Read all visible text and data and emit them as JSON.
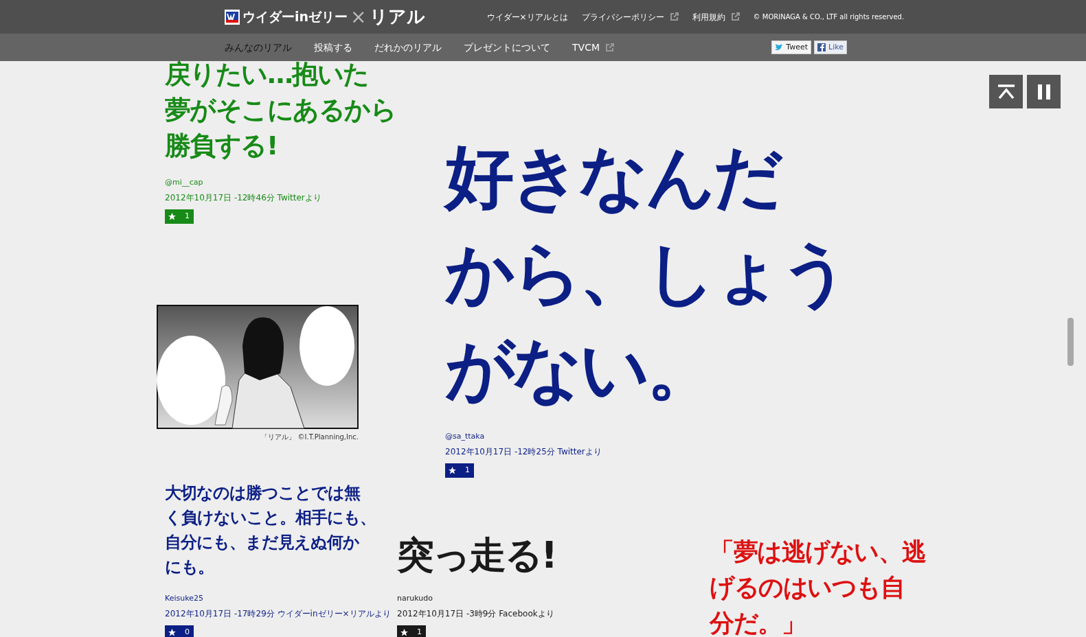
{
  "header": {
    "logo": {
      "brand": "ウイダーinゼリー",
      "cross": "×",
      "title": "リアル"
    },
    "links": [
      {
        "label": "ウイダー×リアルとは",
        "external": false
      },
      {
        "label": "プライバシーポリシー",
        "external": true
      },
      {
        "label": "利用規約",
        "external": true
      }
    ],
    "copyright": "© MORINAGA & CO., LTF all rights reserved."
  },
  "nav": {
    "items": [
      {
        "label": "みんなのリアル",
        "selected": true,
        "external": false
      },
      {
        "label": "投稿する",
        "selected": false,
        "external": false
      },
      {
        "label": "だれかのリアル",
        "selected": false,
        "external": false
      },
      {
        "label": "プレゼントについて",
        "selected": false,
        "external": false
      },
      {
        "label": "TVCM",
        "selected": false,
        "external": true
      }
    ],
    "social": [
      {
        "kind": "twitter",
        "label": "Tweet"
      },
      {
        "kind": "facebook",
        "label": "Like"
      }
    ]
  },
  "cards": [
    {
      "kind": "quote",
      "color": "#178a17",
      "lines": [
        "戻りたい…抱いた",
        "夢がそこにあるから",
        "勝負する!"
      ],
      "user": "@mi__cap",
      "date": "2012年10月17日 -12時46分 Twitterより",
      "likes": "1"
    },
    {
      "kind": "picture",
      "caption": "「リアル」 ©I.T.Planning,Inc."
    },
    {
      "kind": "quote",
      "color": "#0c1f85",
      "lines": [
        "好きなんだ",
        "から、しょう",
        "がない。"
      ],
      "user": "@sa_ttaka",
      "date": "2012年10月17日 -12時25分 Twitterより",
      "likes": "1"
    },
    {
      "kind": "quote",
      "color": "#0c1f85",
      "lines": [
        "大切なのは勝つことでは無",
        "く負けないこと。相手にも、",
        "自分にも、まだ見えぬ何か",
        "にも。"
      ],
      "user": "Keisuke25",
      "date": "2012年10月17日 -17時29分 ウイダーinゼリー×リアルより",
      "likes": "0"
    },
    {
      "kind": "quote",
      "color": "#1a1a1a",
      "lines": [
        "突っ走る!"
      ],
      "user": "narukudo",
      "date": "2012年10月17日 -3時9分 Facebookより",
      "likes": "1"
    },
    {
      "kind": "quote",
      "color": "#dd1111",
      "lines": [
        "「夢は逃げない、逃",
        "げるのはいつも自",
        "分だ。」"
      ]
    }
  ],
  "controls": [
    {
      "kind": "top"
    },
    {
      "kind": "pause"
    }
  ]
}
